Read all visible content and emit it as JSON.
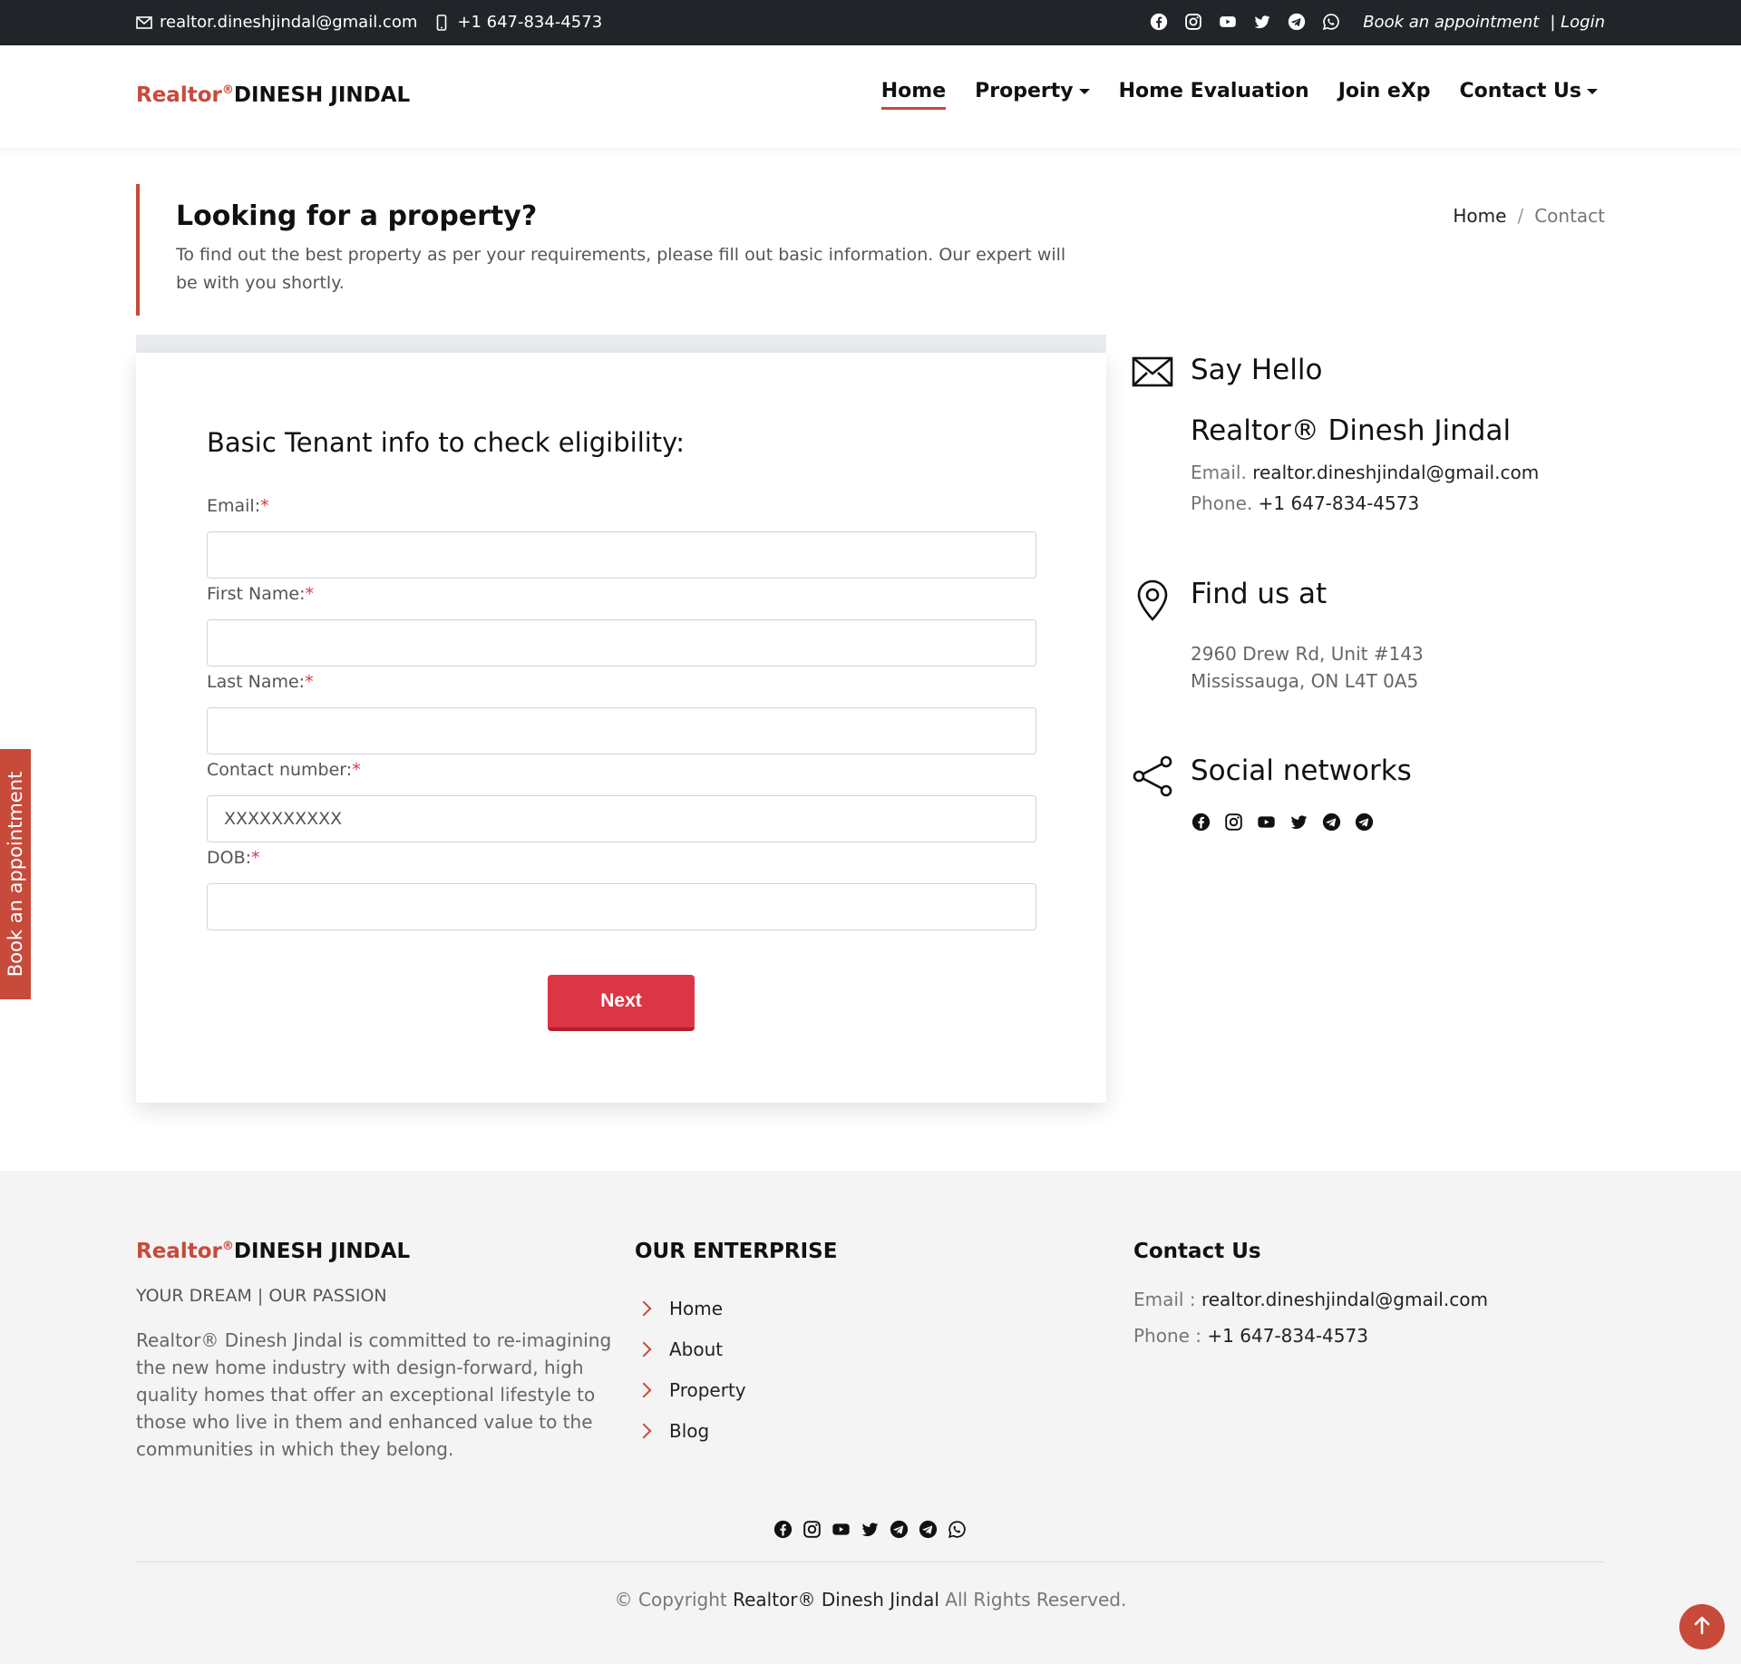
{
  "topbar": {
    "email": "realtor.dineshjindal@gmail.com",
    "phone": "+1 647-834-4573",
    "book": "Book an appointment",
    "login": "| Login"
  },
  "header": {
    "brand_r": "Realtor",
    "brand_sup": "®",
    "brand_name": "DINESH JINDAL",
    "nav": {
      "home": "Home",
      "property": "Property",
      "evaluation": "Home Evaluation",
      "join": "Join eXp",
      "contact": "Contact Us"
    }
  },
  "hero": {
    "title": "Looking for a property?",
    "desc": "To find out the best property as per your requirements, please fill out basic information. Our expert will be with you shortly."
  },
  "breadcrumb": {
    "home": "Home",
    "sep": "/",
    "current": "Contact"
  },
  "form": {
    "title": "Basic Tenant info to check eligibility:",
    "req": "*",
    "email_label": "Email:",
    "first_label": "First Name:",
    "last_label": "Last Name:",
    "contact_label": "Contact number:",
    "contact_placeholder": "XXXXXXXXXX",
    "dob_label": "DOB:",
    "next": "Next"
  },
  "side": {
    "hello_title": "Say Hello",
    "name": "Realtor® Dinesh Jindal",
    "email_label": "Email.",
    "email": "realtor.dineshjindal@gmail.com",
    "phone_label": "Phone.",
    "phone": "+1 647-834-4573",
    "find_title": "Find us at",
    "addr1": "2960 Drew Rd, Unit #143",
    "addr2": "Mississauga, ON L4T 0A5",
    "social_title": "Social networks"
  },
  "book_tab": "Book an appointment",
  "footer": {
    "brand_r": "Realtor",
    "brand_sup": "®",
    "brand_name": "DINESH JINDAL",
    "tagline": "YOUR DREAM | OUR PASSION",
    "desc": "Realtor® Dinesh Jindal is committed to re-imagining the new home industry with design-forward, high quality homes that offer an exceptional lifestyle to those who live in them and enhanced value to the communities in which they belong.",
    "enterprise_title": "OUR ENTERPRISE",
    "links": [
      "Home",
      "About",
      "Property",
      "Blog"
    ],
    "contact_title": "Contact Us",
    "email_label": "Email :",
    "email": "realtor.dineshjindal@gmail.com",
    "phone_label": "Phone :",
    "phone": "+1 647-834-4573",
    "copy_pre": "© Copyright",
    "copy_name": "Realtor® Dinesh Jindal",
    "copy_post": "All Rights Reserved."
  },
  "colors": {
    "accent": "#c74a3a",
    "button": "#dc3545",
    "topbar": "#212529",
    "footer_bg": "#f4f4f4"
  },
  "icons": [
    "envelope-icon",
    "phone-icon",
    "facebook-icon",
    "instagram-icon",
    "youtube-icon",
    "twitter-icon",
    "telegram-icon",
    "whatsapp-icon",
    "map-pin-icon",
    "share-icon",
    "chevron-right-icon",
    "arrow-up-icon"
  ]
}
